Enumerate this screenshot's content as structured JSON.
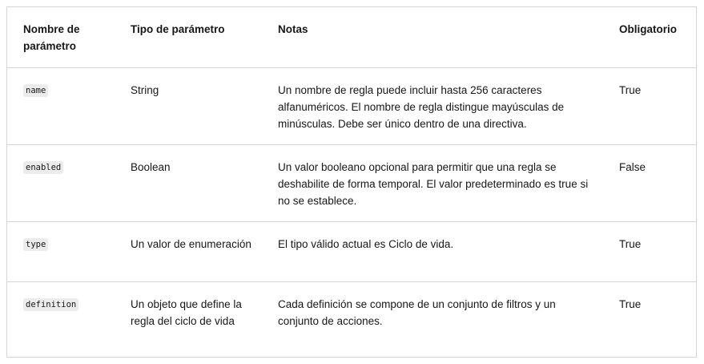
{
  "table": {
    "headers": [
      "Nombre de parámetro",
      "Tipo de parámetro",
      "Notas",
      "Obligatorio"
    ],
    "rows": [
      {
        "name": "name",
        "type": "String",
        "notes": "Un nombre de regla puede incluir hasta 256 caracteres alfanuméricos. El nombre de regla distingue mayúsculas de minúsculas. Debe ser único dentro de una directiva.",
        "required": "True"
      },
      {
        "name": "enabled",
        "type": "Boolean",
        "notes": "Un valor booleano opcional para permitir que una regla se deshabilite de forma temporal. El valor predeterminado es true si no se establece.",
        "required": "False"
      },
      {
        "name": "type",
        "type": "Un valor de enumeración",
        "notes": "El tipo válido actual es Ciclo de vida.",
        "required": "True"
      },
      {
        "name": "definition",
        "type": "Un objeto que define la regla del ciclo de vida",
        "notes": "Cada definición se compone de un conjunto de filtros y un conjunto de acciones.",
        "required": "True"
      }
    ]
  }
}
